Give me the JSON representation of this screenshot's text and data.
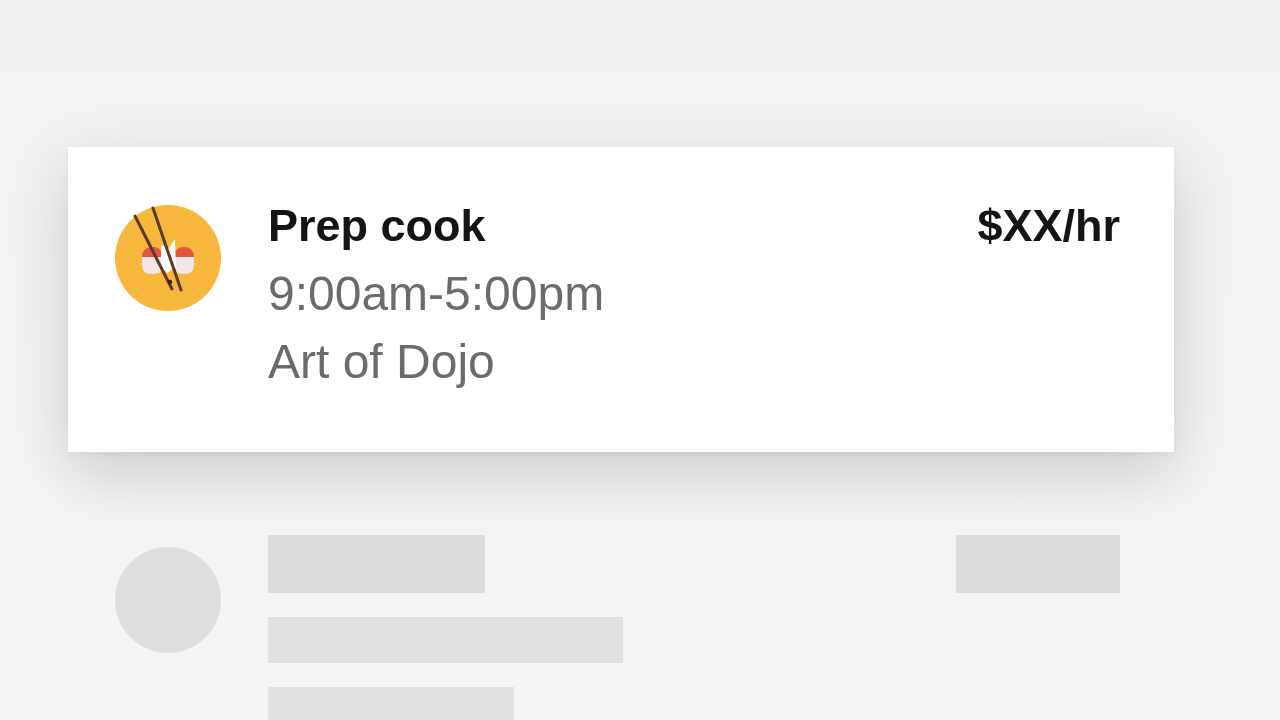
{
  "jobs": [
    {
      "kind": "job",
      "title": "Prep cook",
      "time": "9:00am-5:00pm",
      "venue": "Art of Dojo",
      "pay": "$XX/hr"
    },
    {
      "kind": "skeleton"
    }
  ]
}
